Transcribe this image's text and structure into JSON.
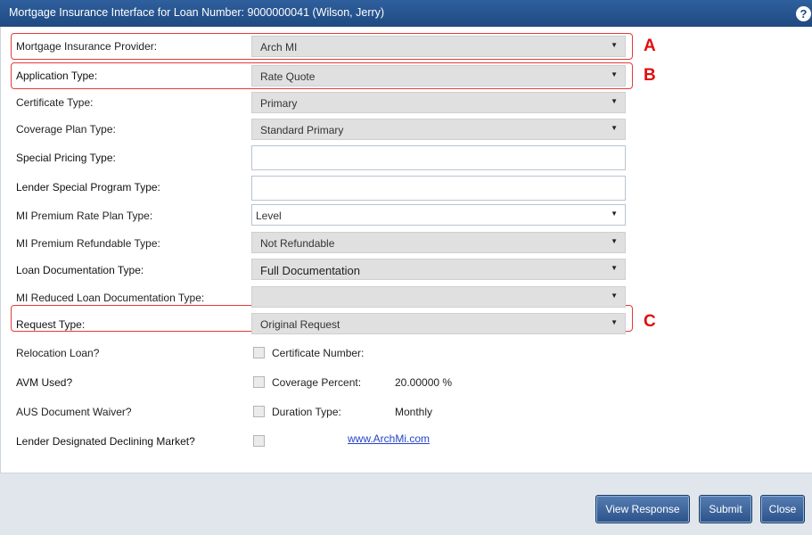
{
  "window": {
    "title": "Mortgage Insurance Interface for Loan Number: 9000000041 (Wilson, Jerry)"
  },
  "fields": {
    "mi_provider": {
      "label": "Mortgage Insurance Provider:",
      "value": "Arch MI"
    },
    "application_type": {
      "label": "Application Type:",
      "value": "Rate Quote"
    },
    "certificate_type": {
      "label": "Certificate Type:",
      "value": "Primary"
    },
    "coverage_plan_type": {
      "label": "Coverage Plan Type:",
      "value": "Standard Primary"
    },
    "special_pricing_type": {
      "label": "Special Pricing Type:",
      "value": ""
    },
    "lender_special_program_type": {
      "label": "Lender Special Program Type:",
      "value": ""
    },
    "mi_premium_rate_plan_type": {
      "label": "MI Premium Rate Plan Type:",
      "value": "Level"
    },
    "mi_premium_refundable_type": {
      "label": "MI Premium Refundable Type:",
      "value": "Not Refundable"
    },
    "loan_documentation_type": {
      "label": "Loan Documentation Type:",
      "value": "Full Documentation"
    },
    "mi_reduced_loan_doc_type": {
      "label": "MI Reduced Loan Documentation Type:",
      "value": ""
    },
    "request_type": {
      "label": "Request Type:",
      "value": "Original Request"
    }
  },
  "checks": {
    "relocation_loan": {
      "label": "Relocation Loan?",
      "checked": false
    },
    "avm_used": {
      "label": "AVM Used?",
      "checked": false
    },
    "aus_document_waiver": {
      "label": "AUS Document Waiver?",
      "checked": false
    },
    "lender_designated_declining_market": {
      "label": "Lender Designated Declining Market?",
      "checked": false
    }
  },
  "info": {
    "certificate_number": {
      "label": "Certificate Number:",
      "value": ""
    },
    "coverage_percent": {
      "label": "Coverage Percent:",
      "value": "20.00000 %"
    },
    "duration_type": {
      "label": "Duration Type:",
      "value": "Monthly"
    }
  },
  "markers": {
    "a": "A",
    "b": "B",
    "c": "C"
  },
  "link": {
    "text": "www.ArchMi.com"
  },
  "buttons": {
    "view_response": "View Response",
    "submit": "Submit",
    "close": "Close"
  },
  "icons": {
    "help": "help-icon",
    "dropdown": "chevron-down-icon"
  },
  "colors": {
    "title_bar": "#1f4a82",
    "highlight": "#e33b3b",
    "marker": "#e00e0e",
    "button": "#2c5389",
    "link": "#2645c8"
  }
}
